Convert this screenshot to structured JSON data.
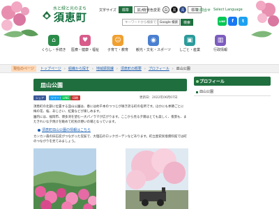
{
  "header": {
    "tagline": "水と緑と光のまち",
    "town_name": "須恵町",
    "text_size_label": "文字サイズ",
    "text_size_options": [
      "標準",
      "拡大"
    ],
    "color_label": "背景色変更",
    "color_options": [
      "白",
      "黒",
      "青"
    ],
    "color_std": "標準",
    "links": [
      "お問合せ",
      "Select Language"
    ],
    "search_placeholder": "キーワードから検索できます",
    "search_engine": "Google 検索",
    "search_button": "検索",
    "sns": [
      "LINE",
      "f",
      "t"
    ]
  },
  "nav": [
    {
      "label": "くらし・手続き",
      "icon": "home-icon",
      "color": "#2b8c4a"
    },
    {
      "label": "医療・健康・福祉",
      "icon": "heart-icon",
      "color": "#d85c8a"
    },
    {
      "label": "子育て・教育",
      "icon": "child-icon",
      "color": "#f0a030"
    },
    {
      "label": "観光・文化・スポーツ",
      "icon": "camera-icon",
      "color": "#4a7fd0"
    },
    {
      "label": "しごと・産業",
      "icon": "briefcase-icon",
      "color": "#2c9b9b"
    },
    {
      "label": "行政情報",
      "icon": "building-icon",
      "color": "#7c5cbf"
    }
  ],
  "breadcrumb": {
    "here_label": "現在のページ",
    "items": [
      "トップページ",
      "組織から探す",
      "地域振興課",
      "須恵町の概要",
      "プロフィール"
    ],
    "current": "皿山公園"
  },
  "main": {
    "title": "皿山公園",
    "share": [
      "シェア",
      "ツイート",
      "LINE",
      "印刷"
    ],
    "updated": "更新日：2022年06月07日",
    "para1": "須恵町の北部に位置する皿山公園は、春には約千本のつつじが咲き誇る町の名所です。ほかにも季節ごとに梅の花、桜、あじさい、紅葉などが楽しめます。",
    "para2": "園内には、福岡市、博多湾を望む一大パノラマが広がります。ここから見る夕陽はとても美しく、夜景も、またきれいな夕焼けを眺めて町民の憩いの場となっています。",
    "link": "須恵町皿山公園の情報はこちら",
    "para3": "カンカン森の旧石炭がつながった炭鉱で、大理石のロックガーデンなどあります。町立歴史民俗資料館では町のつながりを見てみましょう。"
  },
  "sidebar": {
    "title": "プロフィール",
    "items": [
      "皿山公園"
    ]
  },
  "colors": {
    "brand_green": "#1f6f3e",
    "link_blue": "#1c5fb0"
  }
}
